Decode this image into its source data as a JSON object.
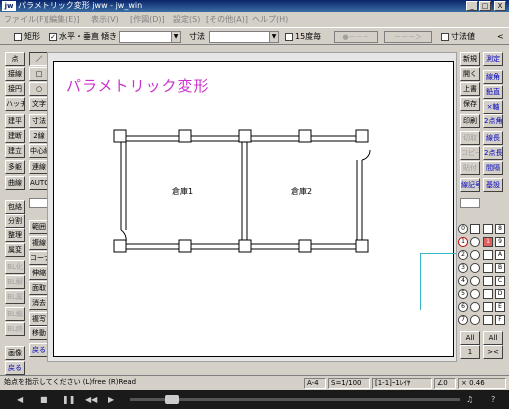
{
  "window": {
    "logo": "jw",
    "title": "パラメトリック変形 jww - jw_win",
    "minimize": "_",
    "maximize": "□",
    "close": "X"
  },
  "menu": [
    "ファイル(F)",
    "[編集(E)]",
    "表示(V)",
    "[作図(D)]",
    "設定(S)",
    "[その他(A)]",
    "ヘルプ(H)"
  ],
  "options": {
    "rect_label": "矩形",
    "hv_label": "水平・垂直",
    "hv_checked": "✓",
    "slope_label": "傾き",
    "dim_label": "寸法",
    "deg15_label": "15度毎",
    "btn1": "●－－－",
    "btn2": "－－－＞",
    "dimvalue_label": "寸法値",
    "more": "<"
  },
  "left_tools": [
    [
      "点",
      "／"
    ],
    [
      "接線",
      "□"
    ],
    [
      "接円",
      "○"
    ],
    [
      "ハッチ",
      "文字"
    ],
    [
      "建平",
      "寸法"
    ],
    [
      "建断",
      "2線"
    ],
    [
      "建立",
      "中心線"
    ],
    [
      "多躯",
      "連線"
    ],
    [
      "曲線",
      "AUTO"
    ]
  ],
  "left_tools2": {
    "row1": "包絡",
    "row2": [
      "分割",
      "範囲"
    ],
    "row3": [
      "整理",
      "複線"
    ],
    "row4": [
      "属変",
      "コーナー"
    ],
    "row5": [
      "BL化",
      "伸縮"
    ],
    "row6": [
      "BL解",
      "面取"
    ],
    "row7": [
      "BL属",
      "消去"
    ],
    "row8": [
      "BL編",
      "複写"
    ],
    "row9": [
      "BL終",
      "移動"
    ],
    "row10": [
      "画像",
      "戻る"
    ],
    "row11": "戻る"
  },
  "right_tools": [
    [
      "新規",
      "測定"
    ],
    [
      "開く",
      "線角"
    ],
    [
      "上書",
      "鉛直"
    ],
    [
      "保存",
      "×軸"
    ],
    [
      "印刷",
      "2点角"
    ],
    [
      "切取",
      "線長"
    ],
    [
      "コピー",
      "2点長"
    ],
    [
      "貼付",
      "間隔"
    ],
    [
      "線記号変形",
      "基設"
    ]
  ],
  "layers": {
    "row1": [
      "0",
      "8"
    ],
    "row2": [
      "1",
      "9"
    ],
    "row3": [
      "2",
      "A"
    ],
    "row4": [
      "3",
      "B"
    ],
    "row5": [
      "4",
      "C"
    ],
    "row6": [
      "5",
      "D"
    ],
    "row7": [
      "6",
      "E"
    ],
    "row8": [
      "7",
      "F"
    ],
    "all1": "All",
    "all2": "All",
    "one": "1",
    "x": "><"
  },
  "drawing": {
    "title": "パラメトリック変形",
    "room1": "倉庫1",
    "room2": "倉庫2",
    "title_color": "#cc33cc"
  },
  "status": {
    "message": "始点を指示してください (L)free (R)Read",
    "paper": "A-4",
    "scale": "S=1/100",
    "layer": "[1-1]ｰ1ﾚｲﾔ",
    "angle": "∠0",
    "zoom": "× 0.46"
  },
  "player": {
    "prev": "◀",
    "stop": "■",
    "pause": "❚❚",
    "next": "▶",
    "rewind": "◀◀",
    "music": "♫",
    "help": "?"
  }
}
